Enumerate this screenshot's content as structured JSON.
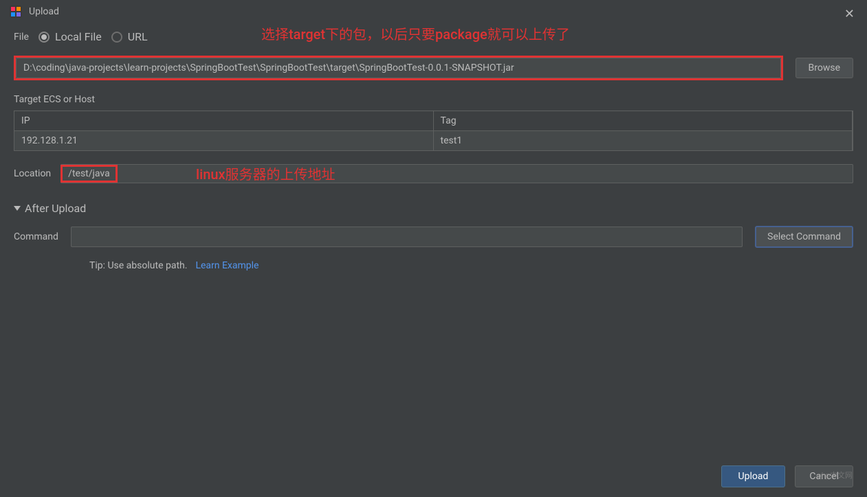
{
  "window": {
    "title": "Upload"
  },
  "file": {
    "label": "File",
    "option_local": "Local File",
    "option_url": "URL"
  },
  "annotations": {
    "select_target": "选择target下的包，以后只要package就可以上传了",
    "linux_upload": "linux服务器的上传地址"
  },
  "path": {
    "value": "D:\\coding\\java-projects\\learn-projects\\SpringBootTest\\SpringBootTest\\target\\SpringBootTest-0.0.1-SNAPSHOT.jar",
    "browse": "Browse"
  },
  "target": {
    "label": "Target ECS or Host",
    "headers": {
      "ip": "IP",
      "tag": "Tag"
    },
    "rows": [
      {
        "ip": "192.128.1.21",
        "tag": "test1"
      }
    ]
  },
  "location": {
    "label": "Location",
    "value": "/test/java"
  },
  "after_upload": {
    "label": "After Upload"
  },
  "command": {
    "label": "Command",
    "select_btn": "Select Command",
    "tip": "Tip: Use absolute path.",
    "link": "Learn Example"
  },
  "footer": {
    "upload": "Upload",
    "cancel": "Cancel"
  },
  "watermark": "php中文网"
}
